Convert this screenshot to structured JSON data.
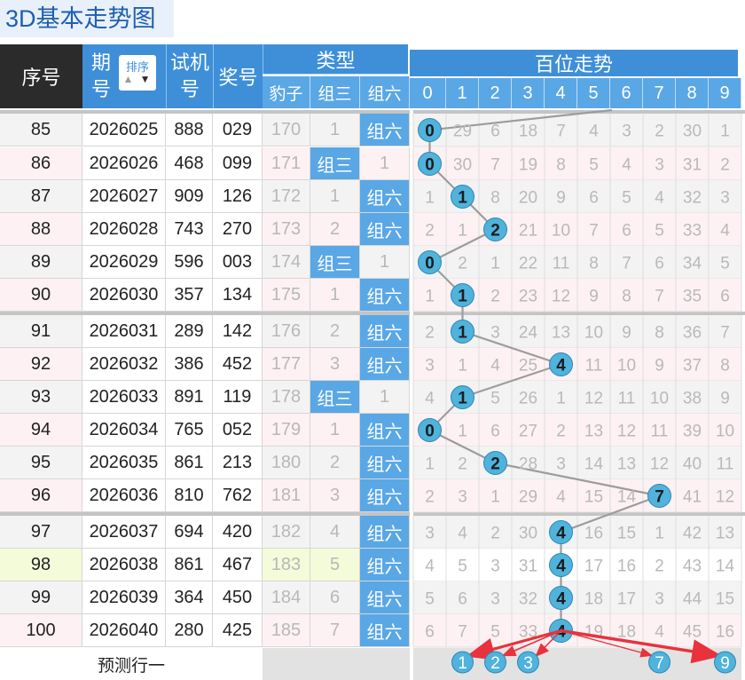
{
  "page_title": "3D基本走势图",
  "headers": {
    "seq": "序号",
    "period": [
      "期",
      "号"
    ],
    "sort_label": "排序",
    "sort_arrows": [
      "▲",
      "▼"
    ],
    "trial": [
      "试机",
      "号"
    ],
    "prize": "奖号",
    "type_group": "类型",
    "type_cols": [
      "豹子",
      "组三",
      "组六"
    ],
    "trend_group": "百位走势",
    "digits": [
      "0",
      "1",
      "2",
      "3",
      "4",
      "5",
      "6",
      "7",
      "8",
      "9"
    ]
  },
  "rows": [
    {
      "seq": "85",
      "period": "2026025",
      "trial": "888",
      "prize": "029",
      "bz": "170",
      "z3": "1",
      "z6": "组六",
      "z6type": "z6",
      "omit": [
        "0",
        "29",
        "6",
        "18",
        "7",
        "4",
        "3",
        "2",
        "30",
        "1"
      ],
      "hit": 0
    },
    {
      "seq": "86",
      "period": "2026026",
      "trial": "468",
      "prize": "099",
      "bz": "171",
      "z3": "组三",
      "z6": "1",
      "z6type": "z3",
      "omit": [
        "0",
        "30",
        "7",
        "19",
        "8",
        "5",
        "4",
        "3",
        "31",
        "2"
      ],
      "hit": 0
    },
    {
      "seq": "87",
      "period": "2026027",
      "trial": "909",
      "prize": "126",
      "bz": "172",
      "z3": "1",
      "z6": "组六",
      "z6type": "z6",
      "omit": [
        "1",
        "1",
        "8",
        "20",
        "9",
        "6",
        "5",
        "4",
        "32",
        "3"
      ],
      "hit": 1
    },
    {
      "seq": "88",
      "period": "2026028",
      "trial": "743",
      "prize": "270",
      "bz": "173",
      "z3": "2",
      "z6": "组六",
      "z6type": "z6",
      "omit": [
        "2",
        "1",
        "2",
        "21",
        "10",
        "7",
        "6",
        "5",
        "33",
        "4"
      ],
      "hit": 2
    },
    {
      "seq": "89",
      "period": "2026029",
      "trial": "596",
      "prize": "003",
      "bz": "174",
      "z3": "组三",
      "z6": "1",
      "z6type": "z3",
      "omit": [
        "0",
        "2",
        "1",
        "22",
        "11",
        "8",
        "7",
        "6",
        "34",
        "5"
      ],
      "hit": 0
    },
    {
      "seq": "90",
      "period": "2026030",
      "trial": "357",
      "prize": "134",
      "bz": "175",
      "z3": "1",
      "z6": "组六",
      "z6type": "z6",
      "omit": [
        "1",
        "1",
        "2",
        "23",
        "12",
        "9",
        "8",
        "7",
        "35",
        "6"
      ],
      "hit": 1
    },
    {
      "seq": "91",
      "period": "2026031",
      "trial": "289",
      "prize": "142",
      "bz": "176",
      "z3": "2",
      "z6": "组六",
      "z6type": "z6",
      "omit": [
        "2",
        "1",
        "3",
        "24",
        "13",
        "10",
        "9",
        "8",
        "36",
        "7"
      ],
      "hit": 1
    },
    {
      "seq": "92",
      "period": "2026032",
      "trial": "386",
      "prize": "452",
      "bz": "177",
      "z3": "3",
      "z6": "组六",
      "z6type": "z6",
      "omit": [
        "3",
        "1",
        "4",
        "25",
        "4",
        "11",
        "10",
        "9",
        "37",
        "8"
      ],
      "hit": 4
    },
    {
      "seq": "93",
      "period": "2026033",
      "trial": "891",
      "prize": "119",
      "bz": "178",
      "z3": "组三",
      "z6": "1",
      "z6type": "z3",
      "omit": [
        "4",
        "1",
        "5",
        "26",
        "1",
        "12",
        "11",
        "10",
        "38",
        "9"
      ],
      "hit": 1
    },
    {
      "seq": "94",
      "period": "2026034",
      "trial": "765",
      "prize": "052",
      "bz": "179",
      "z3": "1",
      "z6": "组六",
      "z6type": "z6",
      "omit": [
        "0",
        "1",
        "6",
        "27",
        "2",
        "13",
        "12",
        "11",
        "39",
        "10"
      ],
      "hit": 0
    },
    {
      "seq": "95",
      "period": "2026035",
      "trial": "861",
      "prize": "213",
      "bz": "180",
      "z3": "2",
      "z6": "组六",
      "z6type": "z6",
      "omit": [
        "1",
        "2",
        "2",
        "28",
        "3",
        "14",
        "13",
        "12",
        "40",
        "11"
      ],
      "hit": 2
    },
    {
      "seq": "96",
      "period": "2026036",
      "trial": "810",
      "prize": "762",
      "bz": "181",
      "z3": "3",
      "z6": "组六",
      "z6type": "z6",
      "omit": [
        "2",
        "3",
        "1",
        "29",
        "4",
        "15",
        "14",
        "7",
        "41",
        "12"
      ],
      "hit": 7
    },
    {
      "seq": "97",
      "period": "2026037",
      "trial": "694",
      "prize": "420",
      "bz": "182",
      "z3": "4",
      "z6": "组六",
      "z6type": "z6",
      "omit": [
        "3",
        "4",
        "2",
        "30",
        "4",
        "16",
        "15",
        "1",
        "42",
        "13"
      ],
      "hit": 4
    },
    {
      "seq": "98",
      "period": "2026038",
      "trial": "861",
      "prize": "467",
      "bz": "183",
      "z3": "5",
      "z6": "组六",
      "z6type": "z6",
      "omit": [
        "4",
        "5",
        "3",
        "31",
        "4",
        "17",
        "16",
        "2",
        "43",
        "14"
      ],
      "hit": 4
    },
    {
      "seq": "99",
      "period": "2026039",
      "trial": "364",
      "prize": "450",
      "bz": "184",
      "z3": "6",
      "z6": "组六",
      "z6type": "z6",
      "omit": [
        "5",
        "6",
        "3",
        "32",
        "4",
        "18",
        "17",
        "3",
        "44",
        "15"
      ],
      "hit": 4
    },
    {
      "seq": "100",
      "period": "2026040",
      "trial": "280",
      "prize": "425",
      "bz": "185",
      "z3": "7",
      "z6": "组六",
      "z6type": "z6",
      "omit": [
        "6",
        "7",
        "5",
        "33",
        "4",
        "19",
        "18",
        "4",
        "45",
        "16"
      ],
      "hit": 4
    }
  ],
  "footer": {
    "label": "预测行一",
    "predictions": [
      "1",
      "2",
      "3",
      "7",
      "9"
    ]
  },
  "colors": {
    "header_dark": "#2b2b2b",
    "header_blue": "#3e8fd8",
    "cell_blue": "#5aa7e6",
    "ball": "#4fb3dc",
    "arrow": "#e8323c",
    "odd_row": "#f3f3f3",
    "even_row": "#fdf1f3",
    "highlight_row": "#f3fbd8"
  }
}
